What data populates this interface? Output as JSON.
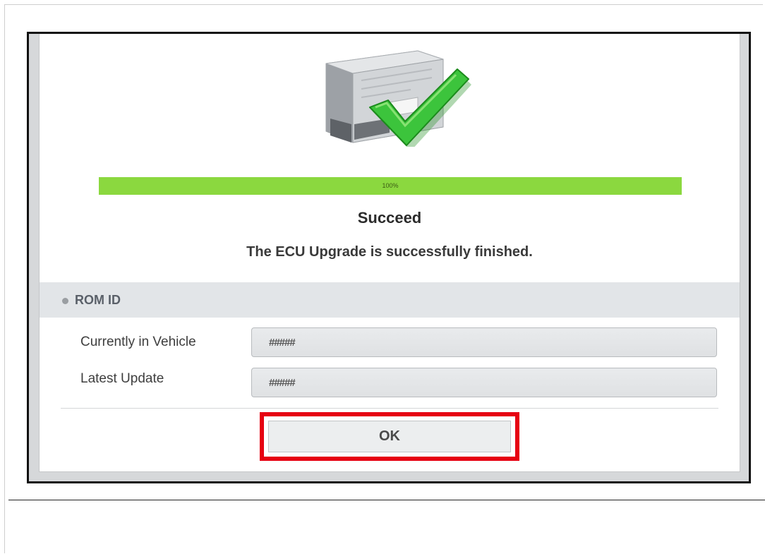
{
  "progress": {
    "label": "100%",
    "fraction": 1.0,
    "fill_color": "#8bd83f"
  },
  "status": {
    "title": "Succeed",
    "message": "The ECU Upgrade is successfully finished."
  },
  "rom": {
    "section_title": "ROM ID",
    "fields": [
      {
        "label": "Currently in Vehicle",
        "value": "#####"
      },
      {
        "label": "Latest Update",
        "value": "#####"
      }
    ]
  },
  "actions": {
    "ok_label": "OK",
    "highlight_color": "#e60012"
  },
  "icons": {
    "illustration": "ecu-with-checkmark-icon"
  }
}
